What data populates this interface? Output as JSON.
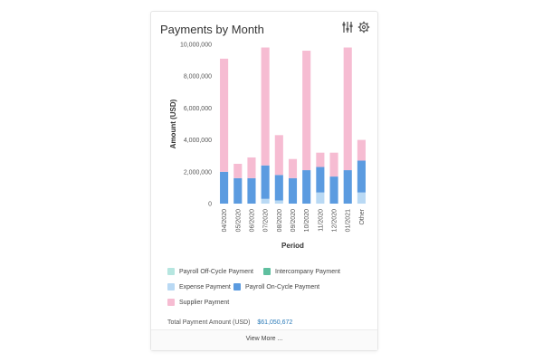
{
  "card": {
    "title": "Payments by Month",
    "icons": [
      "filter-settings-icon",
      "gear-icon"
    ],
    "total_label": "Total Payment Amount (USD)",
    "total_value": "$61,050,672",
    "view_more": "View More ..."
  },
  "colors": {
    "payroll_off_cycle": "#b6e6e0",
    "intercompany": "#5fbf9f",
    "expense": "#b9d9f4",
    "payroll_on_cycle": "#5b9be0",
    "supplier": "#f6bcd2"
  },
  "legend": [
    {
      "name": "Payroll Off-Cycle Payment",
      "color": "#b6e6e0"
    },
    {
      "name": "Intercompany Payment",
      "color": "#5fbf9f"
    },
    {
      "name": "Expense Payment",
      "color": "#b9d9f4"
    },
    {
      "name": "Payroll On-Cycle Payment",
      "color": "#5b9be0"
    },
    {
      "name": "Supplier Payment",
      "color": "#f6bcd2"
    }
  ],
  "chart_data": {
    "type": "bar",
    "stacked": true,
    "xlabel": "Period",
    "ylabel": "Amount (USD)",
    "ylim": [
      0,
      10000000
    ],
    "yticks": [
      "0",
      "2,000,000",
      "4,000,000",
      "6,000,000",
      "8,000,000",
      "10,000,000"
    ],
    "categories": [
      "04/2020",
      "05/2020",
      "06/2020",
      "07/2020",
      "08/2020",
      "09/2020",
      "10/2020",
      "11/2020",
      "12/2020",
      "01/2021",
      "Other"
    ],
    "series": [
      {
        "name": "Expense Payment",
        "color": "#b9d9f4",
        "values": [
          0,
          0,
          0,
          300000,
          200000,
          0,
          0,
          700000,
          0,
          0,
          700000
        ]
      },
      {
        "name": "Payroll On-Cycle Payment",
        "color": "#5b9be0",
        "values": [
          2000000,
          1600000,
          1600000,
          2100000,
          1600000,
          1600000,
          2100000,
          1600000,
          1700000,
          2100000,
          2000000
        ]
      },
      {
        "name": "Supplier Payment",
        "color": "#f6bcd2",
        "values": [
          7100000,
          900000,
          1300000,
          7400000,
          2500000,
          1200000,
          7500000,
          900000,
          1500000,
          7700000,
          1300000
        ]
      }
    ],
    "grid": false,
    "legend_position": "bottom"
  }
}
